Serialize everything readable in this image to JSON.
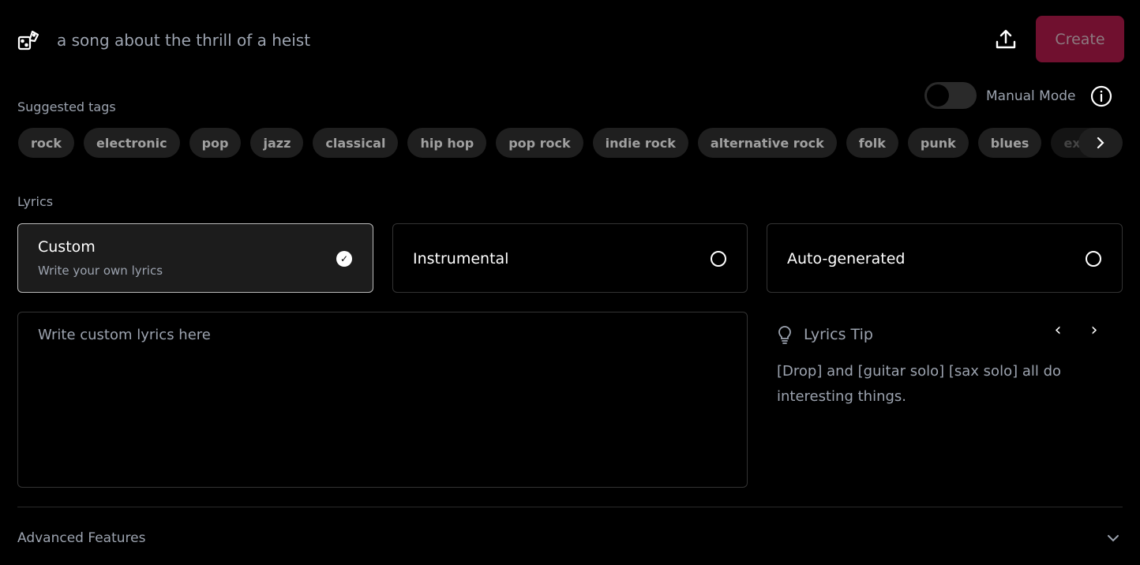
{
  "prompt": {
    "value": "a song about the thrill of a heist",
    "icon": "dice-icon"
  },
  "header": {
    "create_label": "Create",
    "create_color": "#70102f",
    "upload_icon": "upload-icon"
  },
  "manual_mode": {
    "label": "Manual Mode",
    "enabled": false
  },
  "suggested_tags": {
    "label": "Suggested tags",
    "items": [
      "rock",
      "electronic",
      "pop",
      "jazz",
      "classical",
      "hip hop",
      "pop rock",
      "indie rock",
      "alternative rock",
      "folk",
      "punk",
      "blues",
      "experimental"
    ]
  },
  "lyrics": {
    "label": "Lyrics",
    "options": [
      {
        "title": "Custom",
        "subtitle": "Write your own lyrics",
        "selected": true
      },
      {
        "title": "Instrumental",
        "selected": false
      },
      {
        "title": "Auto-generated",
        "selected": false
      }
    ],
    "placeholder": "Write custom lyrics here",
    "value": ""
  },
  "tip": {
    "title": "Lyrics Tip",
    "text": "[Drop] and [guitar solo] [sax solo] all do interesting things."
  },
  "advanced": {
    "label": "Advanced Features"
  }
}
